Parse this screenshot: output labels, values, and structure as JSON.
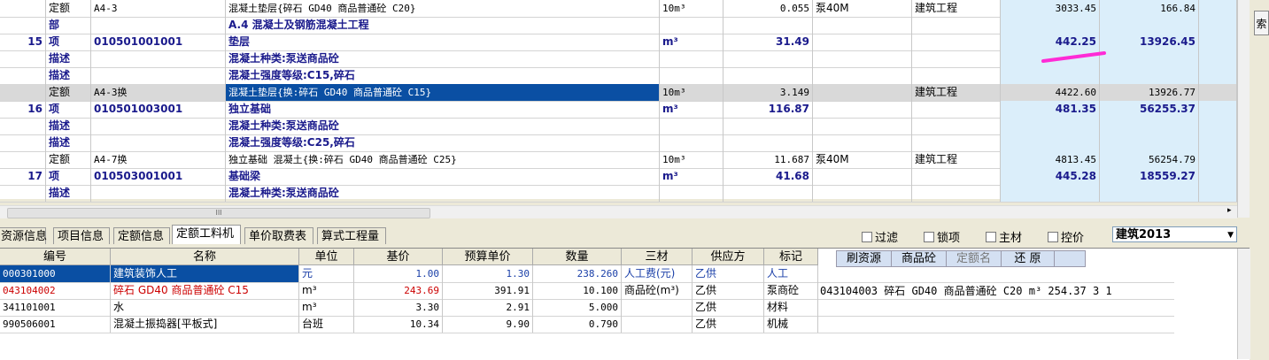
{
  "top_rows": [
    {
      "seq": "",
      "type": "定额",
      "code": "A4-3",
      "name": "混凝土垫层{碎石 GD40  商品普通砼  C20}",
      "unit": "10m³",
      "qty": "0.055",
      "extra": "泵40M",
      "cat": "建筑工程",
      "price": "3033.45",
      "total": "166.84",
      "style": "normal"
    },
    {
      "seq": "",
      "type": "部",
      "code": "",
      "name": "A.4 混凝土及钢筋混凝土工程",
      "unit": "",
      "qty": "",
      "extra": "",
      "cat": "",
      "price": "",
      "total": "",
      "style": "bold"
    },
    {
      "seq": "15",
      "type": "项",
      "code": "010501001001",
      "name": "垫层",
      "unit": "m³",
      "qty": "31.49",
      "extra": "",
      "cat": "",
      "price": "442.25",
      "total": "13926.45",
      "style": "bold"
    },
    {
      "seq": "",
      "type": "描述",
      "code": "",
      "name": "混凝土种类:泵送商品砼",
      "unit": "",
      "qty": "",
      "extra": "",
      "cat": "",
      "price": "",
      "total": "",
      "style": "bold"
    },
    {
      "seq": "",
      "type": "描述",
      "code": "",
      "name": "混凝土强度等级:C15,碎石",
      "unit": "",
      "qty": "",
      "extra": "",
      "cat": "",
      "price": "",
      "total": "",
      "style": "bold"
    },
    {
      "seq": "",
      "type": "定额",
      "code": "A4-3换",
      "name": "混凝土垫层{换:碎石 GD40  商品普通砼  C15}",
      "unit": "10m³",
      "qty": "3.149",
      "extra": "",
      "cat": "建筑工程",
      "price": "4422.60",
      "total": "13926.77",
      "style": "selected"
    },
    {
      "seq": "16",
      "type": "项",
      "code": "010501003001",
      "name": "独立基础",
      "unit": "m³",
      "qty": "116.87",
      "extra": "",
      "cat": "",
      "price": "481.35",
      "total": "56255.37",
      "style": "bold"
    },
    {
      "seq": "",
      "type": "描述",
      "code": "",
      "name": "混凝土种类:泵送商品砼",
      "unit": "",
      "qty": "",
      "extra": "",
      "cat": "",
      "price": "",
      "total": "",
      "style": "bold"
    },
    {
      "seq": "",
      "type": "描述",
      "code": "",
      "name": "混凝土强度等级:C25,碎石",
      "unit": "",
      "qty": "",
      "extra": "",
      "cat": "",
      "price": "",
      "total": "",
      "style": "bold"
    },
    {
      "seq": "",
      "type": "定额",
      "code": "A4-7换",
      "name": "独立基础 混凝土{换:碎石 GD40  商品普通砼  C25}",
      "unit": "10m³",
      "qty": "11.687",
      "extra": "泵40M",
      "cat": "建筑工程",
      "price": "4813.45",
      "total": "56254.79",
      "style": "normal"
    },
    {
      "seq": "17",
      "type": "项",
      "code": "010503001001",
      "name": "基础梁",
      "unit": "m³",
      "qty": "41.68",
      "extra": "",
      "cat": "",
      "price": "445.28",
      "total": "18559.27",
      "style": "bold"
    },
    {
      "seq": "",
      "type": "描述",
      "code": "",
      "name": "混凝土种类:泵送商品砼",
      "unit": "",
      "qty": "",
      "extra": "",
      "cat": "",
      "price": "",
      "total": "",
      "style": "bold"
    }
  ],
  "right_button": "索",
  "scroll_grip": "III",
  "tabs": [
    "资源信息",
    "项目信息",
    "定额信息",
    "定额工料机",
    "单价取费表",
    "算式工程量"
  ],
  "active_tab": 3,
  "checkboxes": [
    "过滤",
    "锁项",
    "主材",
    "控价"
  ],
  "select_value": "建筑2013",
  "bottom_headers": [
    "编号",
    "名称",
    "单位",
    "基价",
    "预算单价",
    "数量",
    "三材",
    "供应方",
    "标记"
  ],
  "bottom_rows": [
    {
      "code": "000301000",
      "name": "建筑装饰人工",
      "unit": "元",
      "base": "1.00",
      "budget": "1.30",
      "qty": "238.260",
      "mat": "人工费(元)",
      "supplier": "乙供",
      "mark": "人工",
      "color": "blue"
    },
    {
      "code": "043104002",
      "name": "碎石 GD40  商品普通砼  C15",
      "unit": "m³",
      "base": "243.69",
      "budget": "391.91",
      "qty": "10.100",
      "mat": "商品砼(m³)",
      "supplier": "乙供",
      "mark": "泵商砼",
      "color": "red"
    },
    {
      "code": "341101001",
      "name": "水",
      "unit": "m³",
      "base": "3.30",
      "budget": "2.91",
      "qty": "5.000",
      "mat": "",
      "supplier": "乙供",
      "mark": "材料",
      "color": "normal"
    },
    {
      "code": "990506001",
      "name": "混凝土振捣器[平板式]",
      "unit": "台班",
      "base": "10.34",
      "budget": "9.90",
      "qty": "0.790",
      "mat": "",
      "supplier": "乙供",
      "mark": "机械",
      "color": "normal"
    }
  ],
  "sub_buttons": [
    "刷资源",
    "商品砼",
    "定额名",
    "还 原"
  ],
  "sub_info": "043104003  碎石 GD40  商品普通砼  C20  m³  254.37   3  1"
}
